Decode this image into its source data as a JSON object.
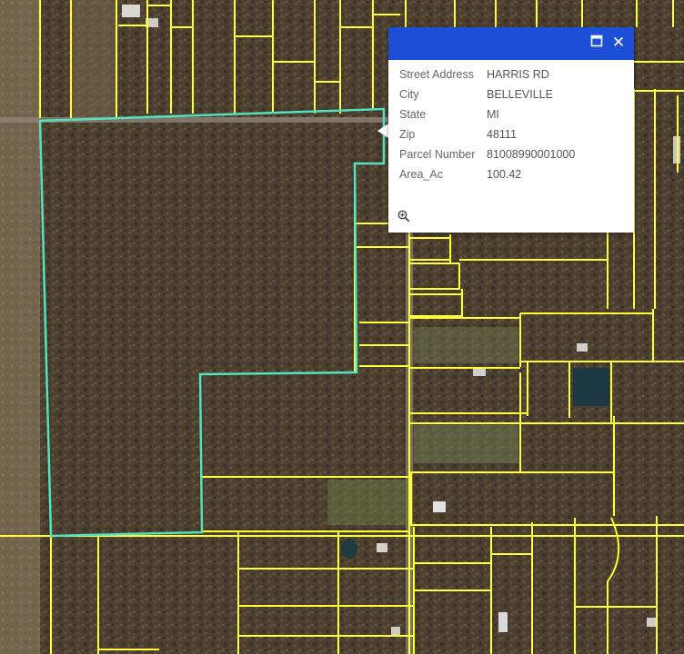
{
  "popup": {
    "fields": [
      {
        "label": "Street Address",
        "value": "HARRIS RD"
      },
      {
        "label": "City",
        "value": "BELLEVILLE"
      },
      {
        "label": "State",
        "value": "MI"
      },
      {
        "label": "Zip",
        "value": "48111"
      },
      {
        "label": "Parcel Number",
        "value": "81008990001000"
      },
      {
        "label": "Area_Ac",
        "value": "100.42"
      }
    ],
    "header_color": "#1c4fd6",
    "controls": [
      "maximize-icon",
      "close-icon"
    ],
    "zoom_icon": "zoom-to-icon"
  },
  "map": {
    "parcel_line_color": "#ffff33",
    "selected_parcel_color": "#55e0c0",
    "basemap": "aerial imagery"
  }
}
